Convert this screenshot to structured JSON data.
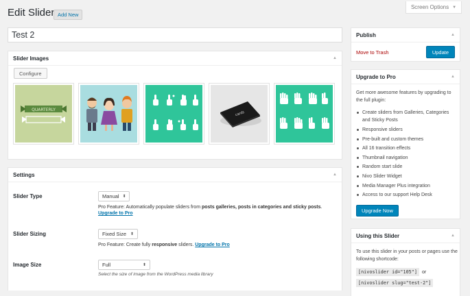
{
  "screen_options": {
    "label": "Screen Options",
    "icon": "caret-down-icon"
  },
  "header": {
    "title": "Edit Slider",
    "add_new": "Add New"
  },
  "title_input": {
    "value": "Test 2"
  },
  "slider_images": {
    "heading": "Slider Images",
    "configure_label": "Configure",
    "thumbnails": [
      {
        "name": "quarterly-banner-image",
        "caption": "QUARTERLY"
      },
      {
        "name": "characters-illustration-image"
      },
      {
        "name": "hand-gestures-image-1"
      },
      {
        "name": "business-cards-image",
        "caption": "cards"
      },
      {
        "name": "hand-gestures-image-2"
      }
    ]
  },
  "settings": {
    "heading": "Settings",
    "slider_type": {
      "label": "Slider Type",
      "value": "Manual",
      "desc_prefix": "Pro Feature:",
      "desc_text1": " Automatically populate sliders from ",
      "desc_bold1": "posts galleries, posts in categories and sticky posts",
      "desc_text2": ". ",
      "desc_link": "Upgrade to Pro"
    },
    "slider_sizing": {
      "label": "Slider Sizing",
      "value": "Fixed Size",
      "desc_prefix": "Pro Feature:",
      "desc_text1": " Create fully ",
      "desc_bold1": "responsive",
      "desc_text2": " sliders. ",
      "desc_link": "Upgrade to Pro"
    },
    "image_size": {
      "label": "Image Size",
      "value": "Full",
      "desc": "Select the size of image from the WordPress media library"
    }
  },
  "publish": {
    "heading": "Publish",
    "trash": "Move to Trash",
    "update": "Update"
  },
  "upgrade": {
    "heading": "Upgrade to Pro",
    "intro": "Get more awesome features by upgrading to the full plugin:",
    "features": [
      "Create sliders from Galleries, Categories and Sticky Posts",
      "Responsive sliders",
      "Pre-built and custom themes",
      "All 16 transition effects",
      "Thumbnail navigation",
      "Random start slide",
      "Nivo Slider Widget",
      "Media Manager Plus integration",
      "Access to our support Help Desk"
    ],
    "button": "Upgrade Now"
  },
  "using": {
    "heading": "Using this Slider",
    "intro": "To use this slider in your posts or pages use the following shortcode:",
    "shortcode1": "[nivoslider id=\"105\"]",
    "or": "or",
    "shortcode2": "[nivoslider slug=\"test-2\"]"
  },
  "colors": {
    "accent": "#0085ba",
    "link": "#0073aa",
    "danger": "#a00",
    "teal": "#2fc59a"
  }
}
